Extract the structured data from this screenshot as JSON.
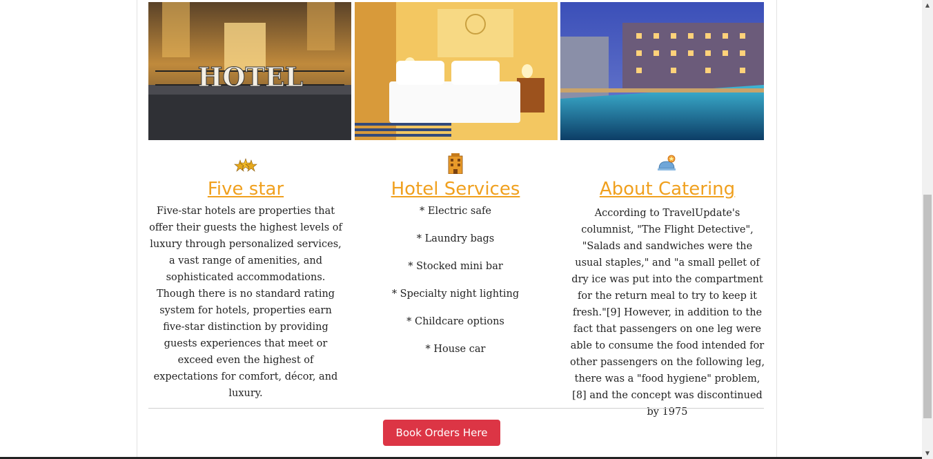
{
  "columns": [
    {
      "title": "Five star",
      "icon": "stars-icon",
      "text": "Five-star hotels are properties that offer their guests the highest levels of luxury through personalized services, a vast range of amenities, and sophisticated accommodations. Though there is no standard rating system for hotels, properties earn five-star distinction by providing guests experiences that meet or exceed even the highest of expectations for comfort, décor, and luxury."
    },
    {
      "title": "Hotel Services",
      "icon": "hotel-building-icon",
      "services": [
        "* Electric safe",
        "* Laundry bags",
        "* Stocked mini bar",
        "* Specialty night lighting",
        "* Childcare options",
        "* House car"
      ]
    },
    {
      "title": "About Catering",
      "icon": "catering-icon",
      "text": "According to TravelUpdate's columnist, \"The Flight Detective\", \"Salads and sandwiches were the usual staples,\" and \"a small pellet of dry ice was put into the compartment for the return meal to try to keep it fresh.\"[9] However, in addition to the fact that passengers on one leg were able to consume the food intended for other passengers on the following leg, there was a \"food hygiene\" problem,[8] and the concept was discontinued by 1975"
    }
  ],
  "photos": {
    "hotel_sign": "HOTEL"
  },
  "book_button": "Book Orders Here",
  "colors": {
    "accent": "#f0a01e",
    "button": "#dc3545"
  }
}
